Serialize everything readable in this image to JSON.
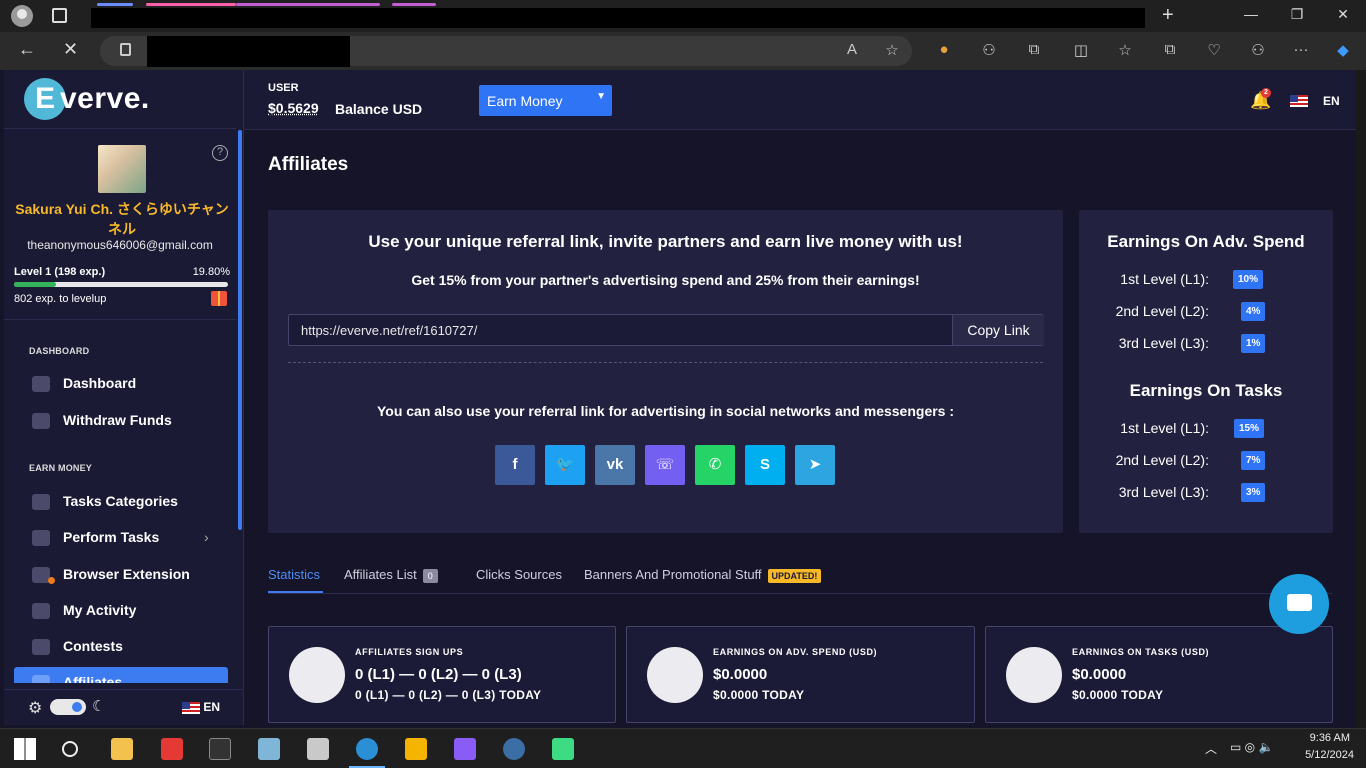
{
  "browser": {
    "nav_back": "←",
    "nav_stop": "✕",
    "read_aloud": "A",
    "favorite": "☆",
    "extensions": "⧉",
    "split": "◫",
    "favorites_bar": "☆",
    "collections": "⧉",
    "health": "♡",
    "profile_sync": "⚇",
    "more": "···"
  },
  "sidebar": {
    "logo_letter": "E",
    "logo_text": "verve.",
    "help": "?",
    "user_name": "Sakura Yui Ch. さくらゆいチャンネル",
    "user_email": "theanonymous646006@gmail.com",
    "level_label": "Level 1 (198 exp.)",
    "level_percent": "19.80%",
    "level_progress": 0.198,
    "level_next": "802 exp. to levelup",
    "sections": {
      "dashboard": "DASHBOARD",
      "earn": "EARN MONEY"
    },
    "items": [
      {
        "label": "Dashboard"
      },
      {
        "label": "Withdraw Funds"
      },
      {
        "label": "Tasks Categories"
      },
      {
        "label": "Perform Tasks"
      },
      {
        "label": "Browser Extension"
      },
      {
        "label": "My Activity"
      },
      {
        "label": "Contests"
      },
      {
        "label": "Affiliates"
      }
    ],
    "footer_lang": "EN"
  },
  "header": {
    "user_label": "USER",
    "balance": "$0.5629",
    "balance_suffix": "Balance USD",
    "earn_select": "Earn Money",
    "notif_count": "2",
    "lang": "EN"
  },
  "main": {
    "title": "Affiliates",
    "ref_heading": "Use your unique referral link, invite partners and earn live money with us!",
    "ref_sub": "Get 15% from your partner's advertising spend and 25% from their earnings!",
    "ref_url": "https://everve.net/ref/1610727/",
    "copy_label": "Copy Link",
    "social_heading": "You can also use your referral link for advertising in social networks and messengers :",
    "social": [
      {
        "name": "facebook",
        "glyph": "f",
        "color": "#3b5998"
      },
      {
        "name": "twitter",
        "glyph": "🐦",
        "color": "#1da1f2"
      },
      {
        "name": "vk",
        "glyph": "vk",
        "color": "#4a76a8"
      },
      {
        "name": "viber",
        "glyph": "☏",
        "color": "#7360f2"
      },
      {
        "name": "whatsapp",
        "glyph": "✆",
        "color": "#25d366"
      },
      {
        "name": "skype",
        "glyph": "S",
        "color": "#00aff0"
      },
      {
        "name": "telegram",
        "glyph": "➤",
        "color": "#2ca5e0"
      }
    ],
    "adv_title": "Earnings On Adv. Spend",
    "adv_levels": [
      {
        "label": "1st Level (L1):",
        "pct": "10%"
      },
      {
        "label": "2nd Level (L2):",
        "pct": "4%"
      },
      {
        "label": "3rd Level (L3):",
        "pct": "1%"
      }
    ],
    "tasks_title": "Earnings On Tasks",
    "task_levels": [
      {
        "label": "1st Level (L1):",
        "pct": "15%"
      },
      {
        "label": "2nd Level (L2):",
        "pct": "7%"
      },
      {
        "label": "3rd Level (L3):",
        "pct": "3%"
      }
    ],
    "tabs": [
      {
        "label": "Statistics"
      },
      {
        "label": "Affiliates List",
        "count": "0"
      },
      {
        "label": "Clicks Sources"
      },
      {
        "label": "Banners And Promotional Stuff",
        "badge": "UPDATED!"
      }
    ],
    "stats": [
      {
        "title": "AFFILIATES SIGN UPS",
        "value": "0 (L1) — 0 (L2) — 0 (L3)",
        "today": "0 (L1) — 0 (L2) — 0 (L3)  TODAY"
      },
      {
        "title": "EARNINGS ON ADV. SPEND (USD)",
        "value": "$0.0000",
        "today": "$0.0000  TODAY"
      },
      {
        "title": "EARNINGS ON TASKS (USD)",
        "value": "$0.0000",
        "today": "$0.0000  TODAY"
      }
    ]
  },
  "taskbar": {
    "time": "9:36 AM",
    "date": "5/12/2024"
  }
}
